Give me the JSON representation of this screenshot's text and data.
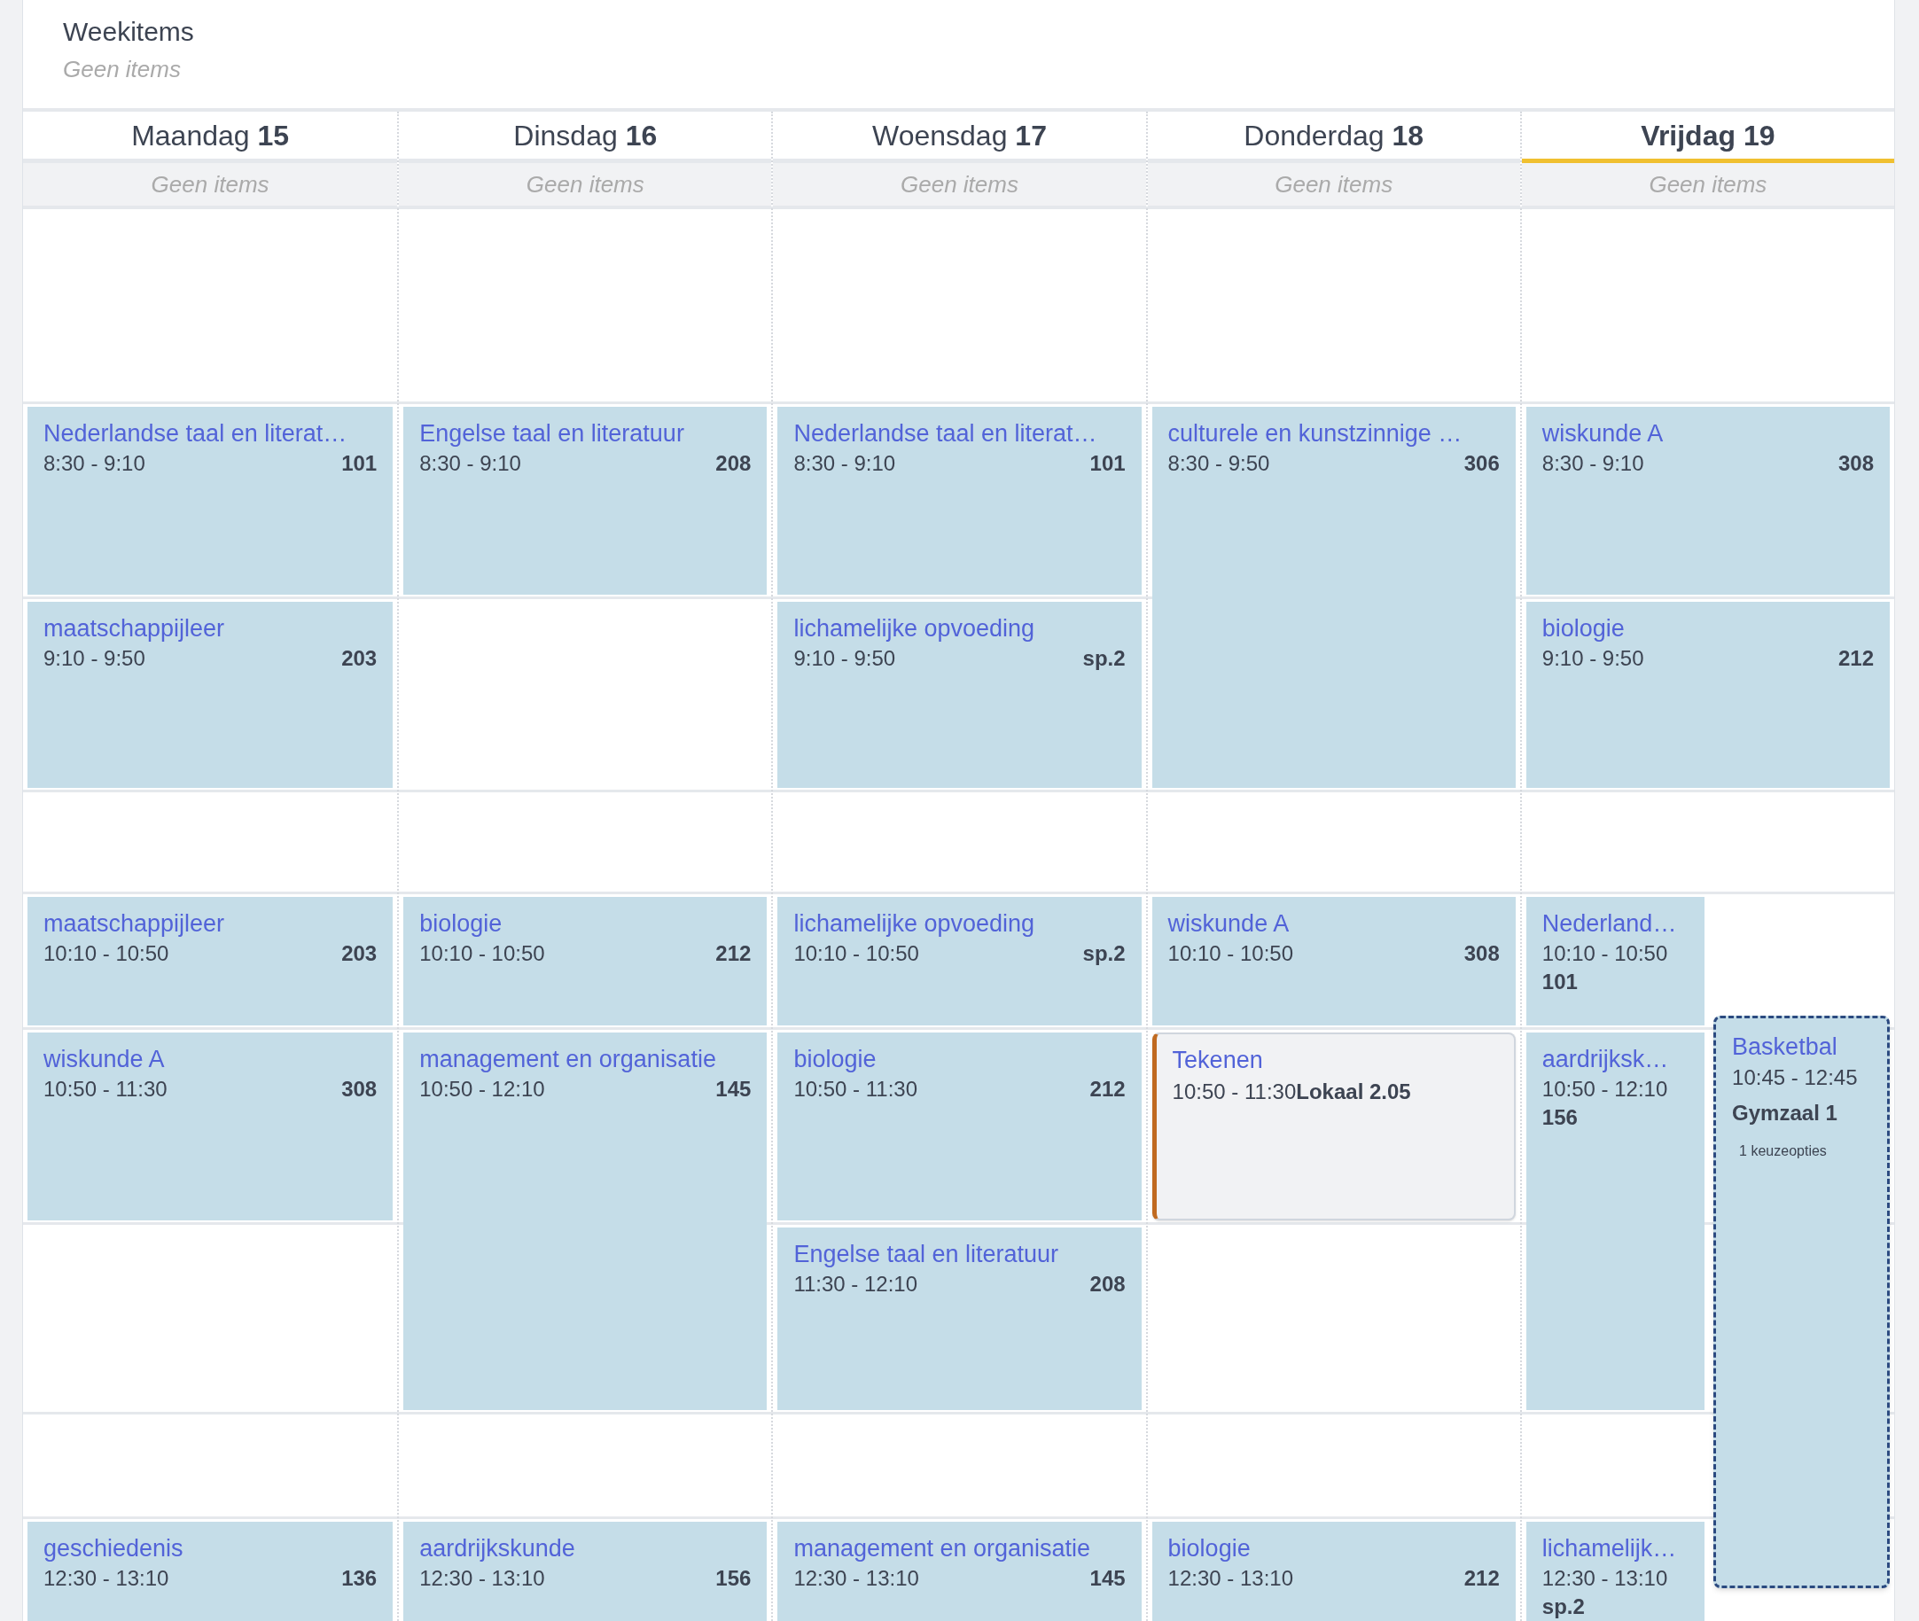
{
  "week_items": {
    "title": "Weekitems",
    "empty_text": "Geen items"
  },
  "days": [
    {
      "label": "Maandag **15**",
      "selected": false,
      "items_text": "Geen items",
      "events": [
        {
          "kind": "lesson",
          "title": "Nederlandse taal en literat…",
          "time": "8:30 - 9:10",
          "room": "101"
        },
        {
          "kind": "lesson",
          "title": "maatschappijleer",
          "time": "9:10 - 9:50",
          "room": "203"
        },
        {
          "kind": "lesson",
          "title": "maatschappijleer",
          "time": "10:10 - 10:50",
          "room": "203"
        },
        {
          "kind": "lesson",
          "title": "wiskunde A",
          "time": "10:50 - 11:30",
          "room": "308"
        },
        {
          "kind": "lesson",
          "title": "geschiedenis",
          "time": "12:30 - 13:10",
          "room": "136"
        }
      ]
    },
    {
      "label": "Dinsdag **16**",
      "selected": false,
      "items_text": "Geen items",
      "events": [
        {
          "kind": "lesson",
          "title": "Engelse taal en literatuur",
          "time": "8:30 - 9:10",
          "room": "208"
        },
        {
          "kind": "lesson",
          "title": "biologie",
          "time": "10:10 - 10:50",
          "room": "212"
        },
        {
          "kind": "lesson",
          "title": "management en organisatie",
          "time": "10:50 - 12:10",
          "room": "145"
        },
        {
          "kind": "lesson",
          "title": "aardrijkskunde",
          "time": "12:30 - 13:10",
          "room": "156"
        }
      ]
    },
    {
      "label": "Woensdag **17**",
      "selected": false,
      "items_text": "Geen items",
      "events": [
        {
          "kind": "lesson",
          "title": "Nederlandse taal en literat…",
          "time": "8:30 - 9:10",
          "room": "101"
        },
        {
          "kind": "lesson",
          "title": "lichamelijke opvoeding",
          "time": "9:10 - 9:50",
          "room": "sp.2"
        },
        {
          "kind": "lesson",
          "title": "lichamelijke opvoeding",
          "time": "10:10 - 10:50",
          "room": "sp.2"
        },
        {
          "kind": "lesson",
          "title": "biologie",
          "time": "10:50 - 11:30",
          "room": "212"
        },
        {
          "kind": "lesson",
          "title": "Engelse taal en literatuur",
          "time": "11:30 - 12:10",
          "room": "208"
        },
        {
          "kind": "lesson",
          "title": "management en organisatie",
          "time": "12:30 - 13:10",
          "room": "145"
        }
      ]
    },
    {
      "label": "Donderdag **18**",
      "selected": false,
      "items_text": "Geen items",
      "events": [
        {
          "kind": "lesson",
          "title": "culturele en kunstzinnige …",
          "time": "8:30 - 9:50",
          "room": "306"
        },
        {
          "kind": "lesson",
          "title": "wiskunde A",
          "time": "10:10 - 10:50",
          "room": "308"
        },
        {
          "kind": "appointment",
          "title": "Tekenen",
          "time": "10:50 - 11:30",
          "room": "Lokaal 2.05"
        },
        {
          "kind": "lesson",
          "title": "biologie",
          "time": "12:30 - 13:10",
          "room": "212"
        }
      ]
    },
    {
      "label": "Vrijdag 19",
      "selected": true,
      "items_text": "Geen items",
      "events": [
        {
          "kind": "lesson",
          "title": "wiskunde A",
          "time": "8:30 - 9:10",
          "room": "308"
        },
        {
          "kind": "lesson",
          "title": "biologie",
          "time": "9:10 - 9:50",
          "room": "212"
        },
        {
          "kind": "lesson",
          "title": "Nederland…",
          "time": "10:10 - 10:50",
          "room": "101"
        },
        {
          "kind": "lesson",
          "title": "aardrijksk…",
          "time": "10:50 - 12:10",
          "room": "156"
        },
        {
          "kind": "lesson",
          "title": "lichamelijk…",
          "time": "12:30 - 13:10",
          "room": "sp.2"
        },
        {
          "kind": "activity",
          "title": "Basketbal",
          "time": "10:45 - 12:45",
          "room": "Gymzaal 1",
          "note": "1 keuzeopties"
        }
      ]
    }
  ]
}
